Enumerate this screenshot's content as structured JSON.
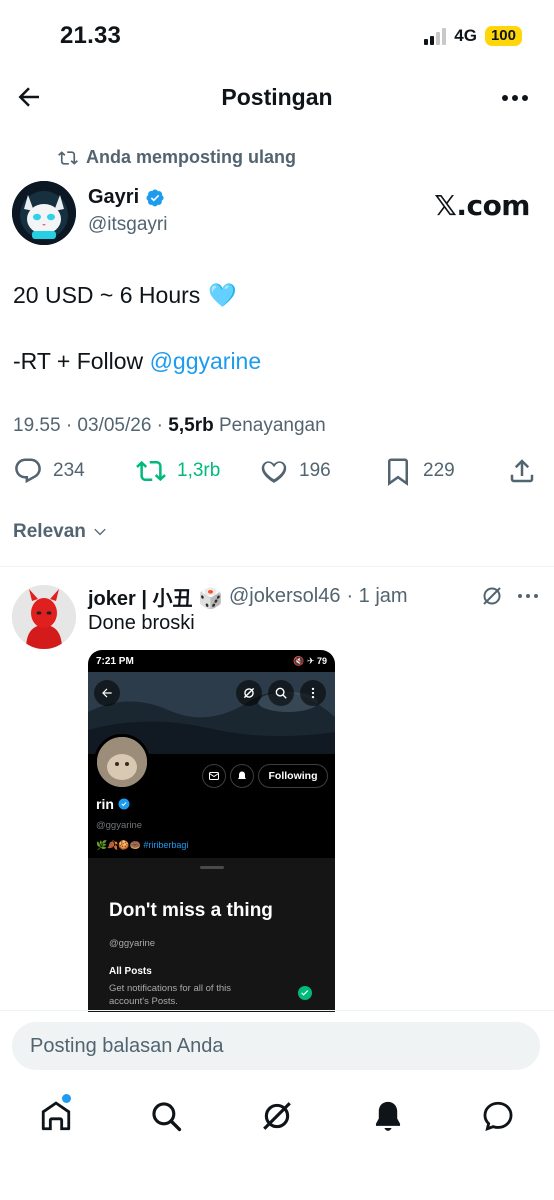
{
  "status_bar": {
    "time": "21.33",
    "network": "4G",
    "battery": "100"
  },
  "header": {
    "title": "Postingan"
  },
  "repost_note": "Anda memposting ulang",
  "post": {
    "name": "Gayri",
    "handle": "@itsgayri",
    "source_badge": "𝕏.com",
    "line1": "20 USD ~ 6 Hours",
    "line1_emoji": "🩵",
    "line2_prefix": "-RT + Follow ",
    "line2_mention": "@ggyarine",
    "meta_time": "19.55 · 03/05/26 · ",
    "meta_views": "5,5rb",
    "meta_views_label": " Penayangan",
    "replies": "234",
    "reposts": "1,3rb",
    "likes": "196",
    "bookmarks": "229"
  },
  "sort_label": "Relevan",
  "reply": {
    "name": "joker | 小丑 🎲",
    "handle": "@jokersol46",
    "time": "· 1 jam",
    "text": "Done broski",
    "embedded": {
      "time": "7:21 PM",
      "status_right": "🔇 ✈ 79",
      "profile_name": "rin",
      "profile_handle": "@ggyarine",
      "profile_emoji": "🌿🍂🍪🍩 #ririberbagi",
      "following_label": "Following",
      "sheet_title": "Don't miss a thing",
      "sheet_handle": "@ggyarine",
      "option_title": "All Posts",
      "option_desc": "Get notifications for all of this account's Posts."
    }
  },
  "reply_input": {
    "placeholder": "Posting balasan Anda"
  },
  "colors": {
    "accent": "#1d9bf0",
    "repost_green": "#00ba7c",
    "muted": "#536471"
  },
  "icons": [
    "back-arrow-icon",
    "more-icon",
    "repost-icon",
    "verified-icon",
    "reply-icon",
    "like-icon",
    "bookmark-icon",
    "share-icon",
    "chevron-down-icon",
    "grok-icon",
    "home-icon",
    "search-icon",
    "bell-icon",
    "messages-icon"
  ]
}
